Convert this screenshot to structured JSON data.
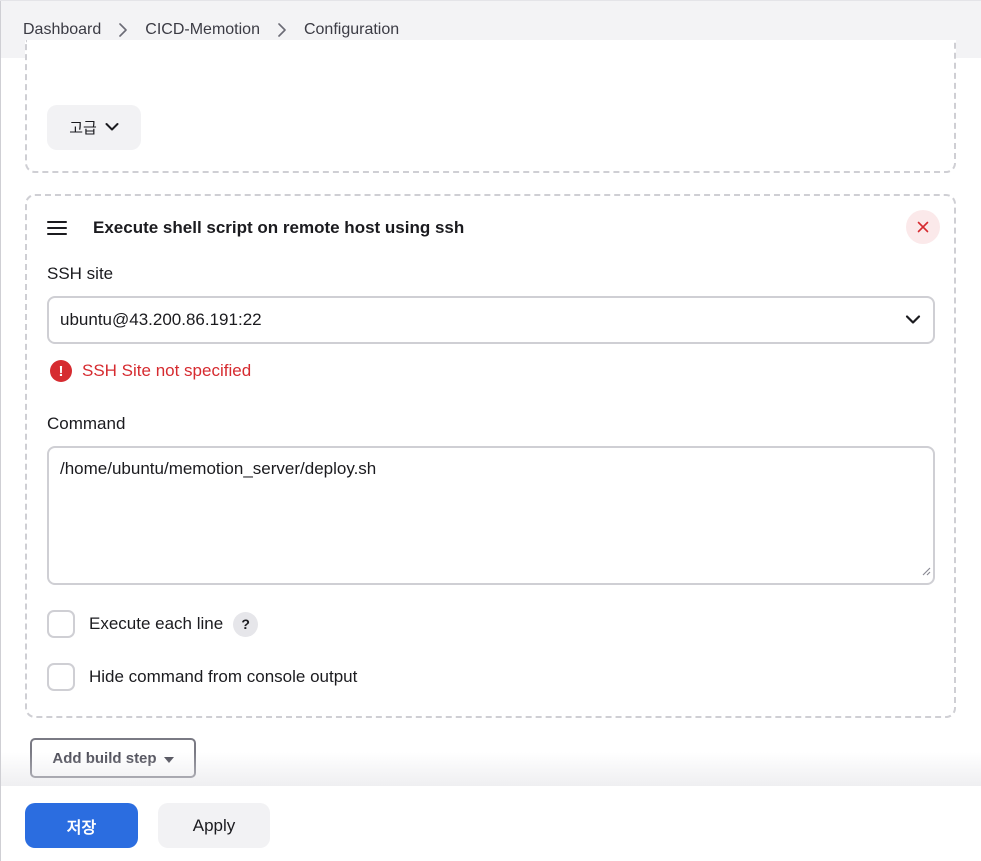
{
  "breadcrumb": {
    "items": [
      "Dashboard",
      "CICD-Memotion",
      "Configuration"
    ]
  },
  "advanced": {
    "label": "고급",
    "icon": "chevron-down-icon"
  },
  "build_step": {
    "title": "Execute shell script on remote host using ssh",
    "drag_icon": "hamburger-icon",
    "close_icon": "close-icon",
    "ssh_site": {
      "label": "SSH site",
      "value": "ubuntu@43.200.86.191:22",
      "error": "SSH Site not specified"
    },
    "command": {
      "label": "Command",
      "value": "/home/ubuntu/memotion_server/deploy.sh"
    },
    "options": {
      "execute_each_line": {
        "label": "Execute each line",
        "checked": false,
        "help": "?"
      },
      "hide_command": {
        "label": "Hide command from console output",
        "checked": false
      }
    }
  },
  "add_build_step": {
    "label": "Add build step"
  },
  "footer": {
    "save_label": "저장",
    "apply_label": "Apply"
  },
  "colors": {
    "primary": "#2b6de0",
    "error": "#d62b30",
    "border": "#cfcfd4",
    "breadcrumb_bg": "#f3f3f5"
  }
}
